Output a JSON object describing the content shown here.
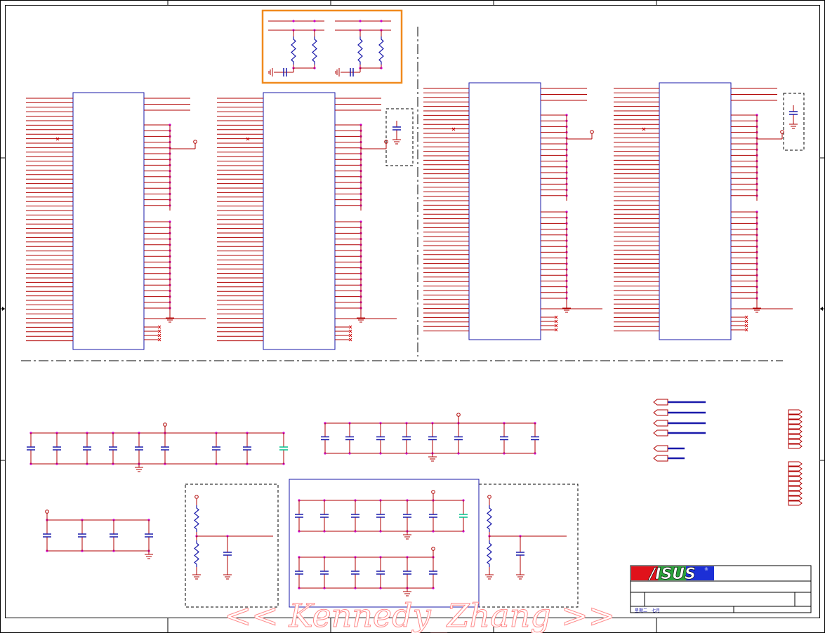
{
  "sheet": {
    "title_block": {
      "logo_text": "/ISUS",
      "logo_mark": "®",
      "date_label": "星期二",
      "date_value": "七月"
    },
    "watermark": "<< Kennedy_Zhang >>"
  },
  "colors": {
    "wire": "#b00000",
    "component": "#1a1aaa",
    "pin_dot": "#cc00cc",
    "frame": "#000000",
    "highlight": "#f08a1e",
    "nc_marker": "#cc0000",
    "watermark": "#ff9999",
    "logo_red": "#e0121b",
    "logo_blue": "#1c2fd6"
  },
  "icons": [
    "ground-icon",
    "power-icon",
    "no-connect-icon",
    "port-connector-icon",
    "resistor-icon",
    "capacitor-icon"
  ]
}
